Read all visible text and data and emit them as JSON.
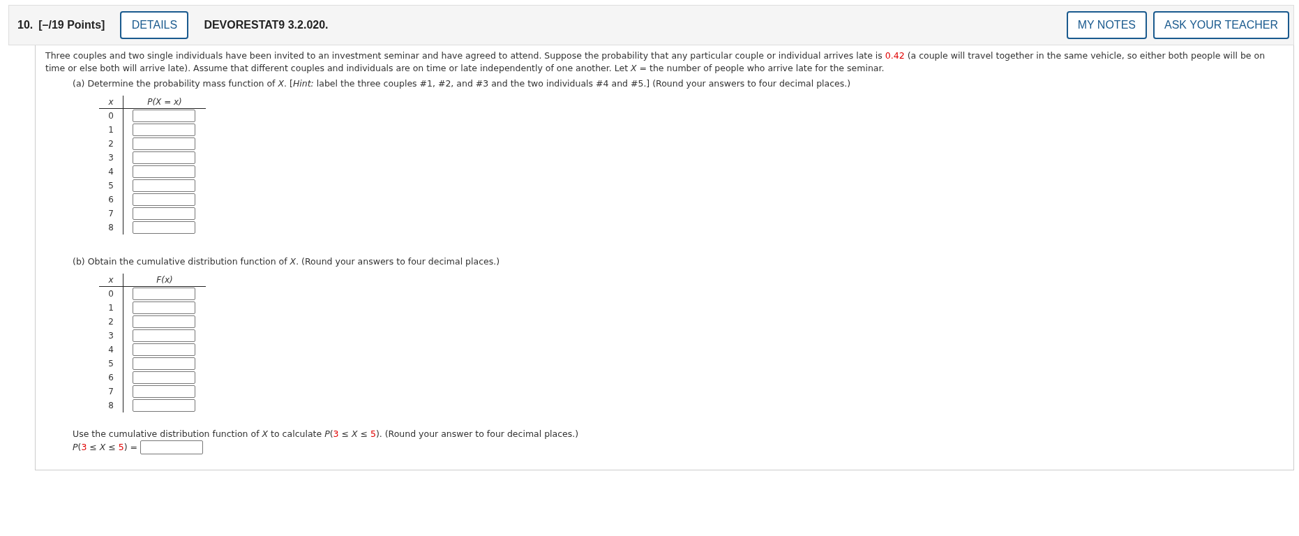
{
  "question": {
    "number": "10.",
    "points": "[–/19 Points]",
    "details_button": "DETAILS",
    "code": "DEVORESTAT9 3.2.020.",
    "buttons": [
      "MY NOTES",
      "ASK YOUR TEACHER"
    ]
  },
  "intro": [
    {
      "kind": "text",
      "text": "Three couples and two single individuals have been invited to an investment seminar and have agreed to attend. Suppose the probability that any particular couple or individual arrives late is "
    },
    {
      "kind": "given",
      "text": "0.42"
    },
    {
      "kind": "text",
      "text": " (a couple will travel together in the same vehicle, so either both people will be on time or else both will arrive late). Assume that different couples and individuals are on time or late independently of one another. Let *X* = the number of people who arrive late for the seminar."
    }
  ],
  "parts": [
    {
      "prompt": "(a) Determine the probability mass function of *X*. [*Hint:* label the three couples #1, #2, and #3 and the two individuals #4 and #5.] (Round your answers to four decimal places.)",
      "table": {
        "columns": [
          "x",
          "P(X = x)"
        ],
        "rows": [
          "0",
          "1",
          "2",
          "3",
          "4",
          "5",
          "6",
          "7",
          "8"
        ]
      }
    },
    {
      "prompt": "(b) Obtain the cumulative distribution function of *X*. (Round your answers to four decimal places.)",
      "table": {
        "columns": [
          "x",
          "F(x)"
        ],
        "rows": [
          "0",
          "1",
          "2",
          "3",
          "4",
          "5",
          "6",
          "7",
          "8"
        ]
      }
    }
  ],
  "followup": {
    "prompt": [
      {
        "kind": "text",
        "text": "Use the cumulative distribution function of *X* to calculate *P*("
      },
      {
        "kind": "given",
        "text": "3"
      },
      {
        "kind": "text",
        "text": " ≤ *X* ≤ "
      },
      {
        "kind": "given",
        "text": "5"
      },
      {
        "kind": "text",
        "text": "). (Round your answer to four decimal places.)"
      }
    ],
    "label": [
      {
        "kind": "text",
        "text": "*P*("
      },
      {
        "kind": "given",
        "text": "3"
      },
      {
        "kind": "text",
        "text": " ≤ *X* ≤ "
      },
      {
        "kind": "given",
        "text": "5"
      },
      {
        "kind": "text",
        "text": ") ="
      }
    ]
  }
}
